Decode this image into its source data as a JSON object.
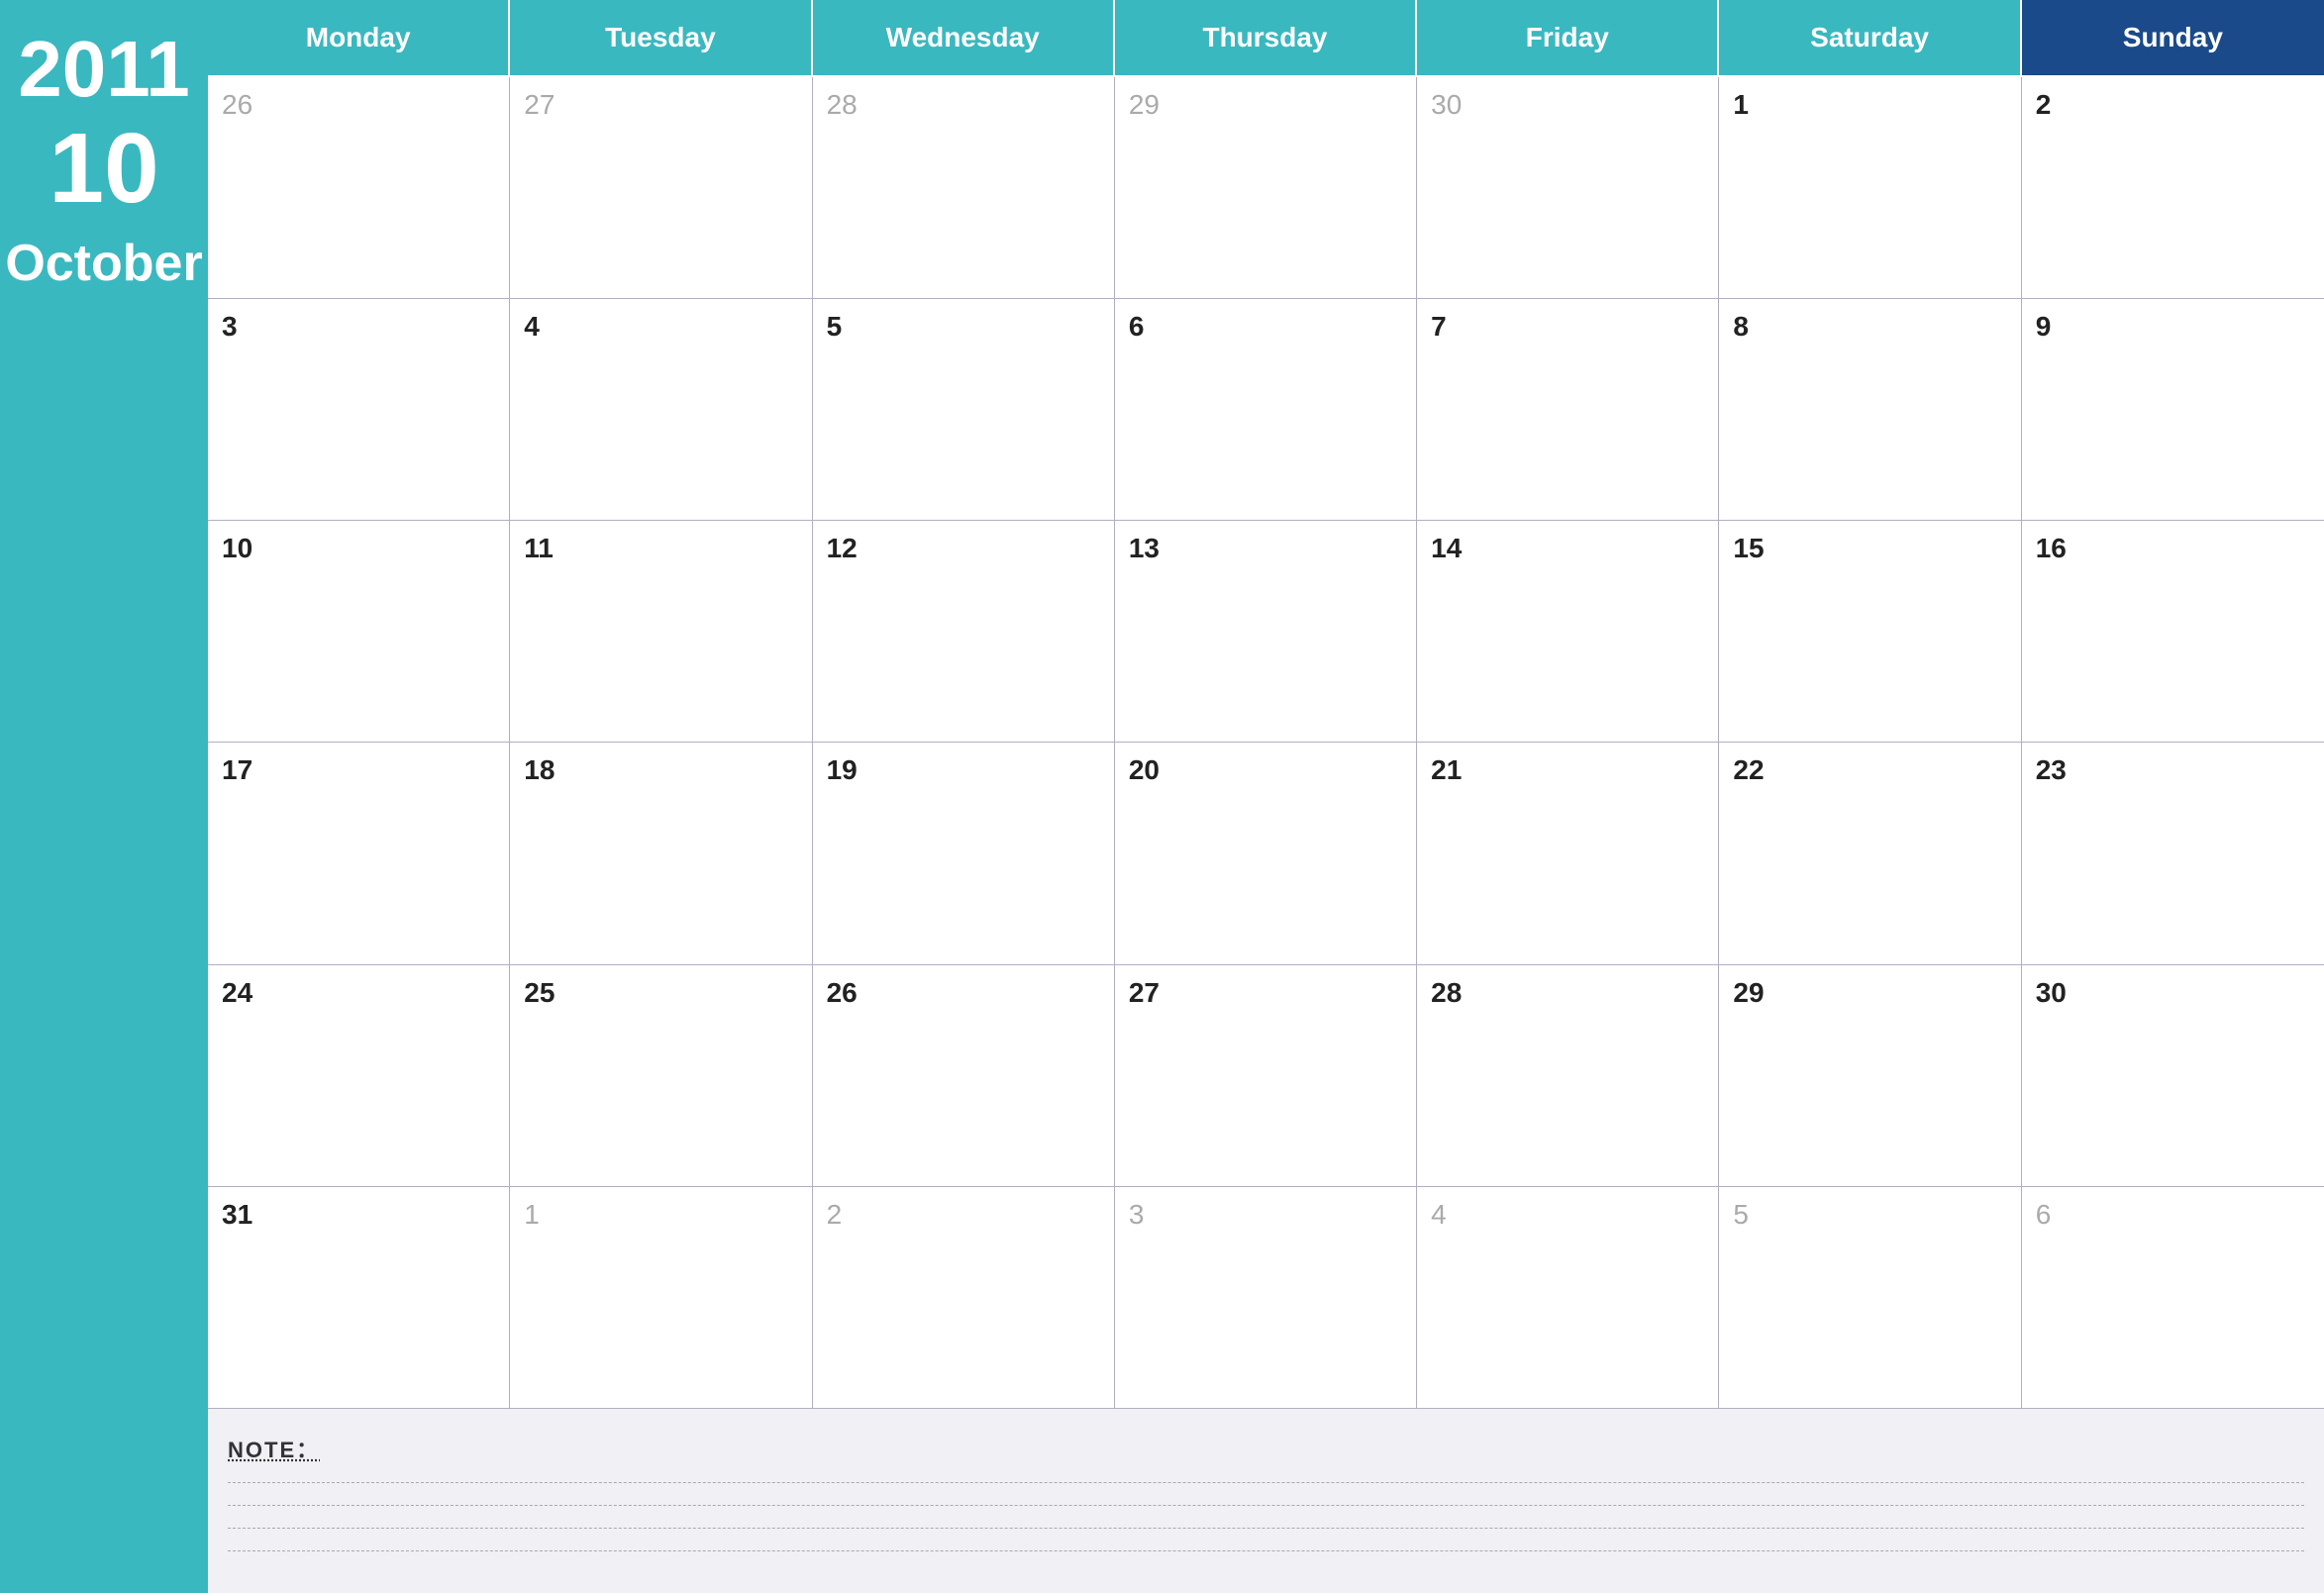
{
  "sidebar": {
    "year": "2011",
    "month_number": "10",
    "month_name": "October"
  },
  "calendar": {
    "day_headers": [
      "Monday",
      "Tuesday",
      "Wednesday",
      "Thursday",
      "Friday",
      "Saturday",
      "Sunday"
    ],
    "weeks": [
      [
        {
          "number": "26",
          "muted": true
        },
        {
          "number": "27",
          "muted": true
        },
        {
          "number": "28",
          "muted": true
        },
        {
          "number": "29",
          "muted": true
        },
        {
          "number": "30",
          "muted": true
        },
        {
          "number": "1",
          "muted": false
        },
        {
          "number": "2",
          "muted": false
        }
      ],
      [
        {
          "number": "3",
          "muted": false
        },
        {
          "number": "4",
          "muted": false
        },
        {
          "number": "5",
          "muted": false
        },
        {
          "number": "6",
          "muted": false
        },
        {
          "number": "7",
          "muted": false
        },
        {
          "number": "8",
          "muted": false
        },
        {
          "number": "9",
          "muted": false
        }
      ],
      [
        {
          "number": "10",
          "muted": false
        },
        {
          "number": "11",
          "muted": false
        },
        {
          "number": "12",
          "muted": false
        },
        {
          "number": "13",
          "muted": false
        },
        {
          "number": "14",
          "muted": false
        },
        {
          "number": "15",
          "muted": false
        },
        {
          "number": "16",
          "muted": false
        }
      ],
      [
        {
          "number": "17",
          "muted": false
        },
        {
          "number": "18",
          "muted": false
        },
        {
          "number": "19",
          "muted": false
        },
        {
          "number": "20",
          "muted": false
        },
        {
          "number": "21",
          "muted": false
        },
        {
          "number": "22",
          "muted": false
        },
        {
          "number": "23",
          "muted": false
        }
      ],
      [
        {
          "number": "24",
          "muted": false
        },
        {
          "number": "25",
          "muted": false
        },
        {
          "number": "26",
          "muted": false
        },
        {
          "number": "27",
          "muted": false
        },
        {
          "number": "28",
          "muted": false
        },
        {
          "number": "29",
          "muted": false
        },
        {
          "number": "30",
          "muted": false
        }
      ],
      [
        {
          "number": "31",
          "muted": false
        },
        {
          "number": "1",
          "muted": true
        },
        {
          "number": "2",
          "muted": true
        },
        {
          "number": "3",
          "muted": true
        },
        {
          "number": "4",
          "muted": true
        },
        {
          "number": "5",
          "muted": true
        },
        {
          "number": "6",
          "muted": true
        }
      ]
    ]
  },
  "notes": {
    "label": "NOTE："
  }
}
